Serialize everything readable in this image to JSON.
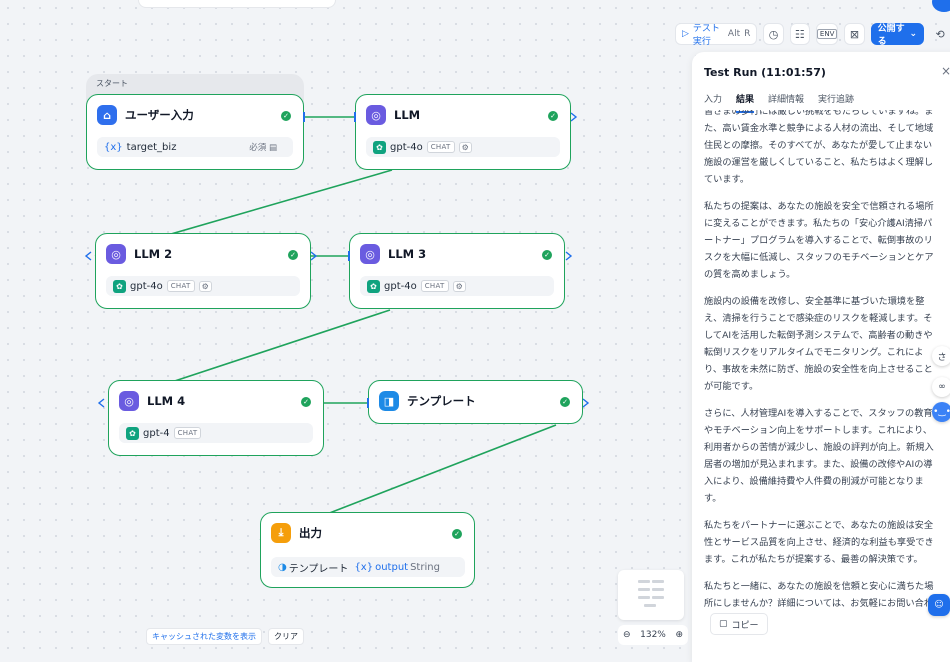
{
  "toolbar": {
    "test_run_label": "テスト実行",
    "test_run_shortcut_alt": "Alt",
    "test_run_shortcut_key": "R",
    "env_label": "ENV",
    "publish_label": "公開する",
    "publish_chevron": "⌄"
  },
  "panel": {
    "title": "Test Run (11:01:57)",
    "close_glyph": "×",
    "tabs": [
      {
        "label": "入力"
      },
      {
        "label": "結果"
      },
      {
        "label": "詳細情報"
      },
      {
        "label": "実行追跡"
      }
    ],
    "active_tab": "結果",
    "paragraphs": [
      "皆さまの歩行には厳しい挑戦をもたらしていますね。また、高い賃金水準と競争による人材の流出、そして地域住民との摩擦。そのすべてが、あなたが愛して止まない施設の運営を厳しくしていること、私たちはよく理解しています。",
      "私たちの提案は、あなたの施設を安全で信頼される場所に変えることができます。私たちの「安心介護AI清掃パートナー」プログラムを導入することで、転倒事故のリスクを大幅に低減し、スタッフのモチベーションとケアの質を高めましょう。",
      "施設内の設備を改修し、安全基準に基づいた環境を整え、清掃を行うことで感染症のリスクを軽減します。そしてAIを活用した転倒予測システムで、高齢者の動きや転倒リスクをリアルタイムでモニタリング。これにより、事故を未然に防ぎ、施設の安全性を向上させることが可能です。",
      "さらに、人材管理AIを導入することで、スタッフの教育やモチベーション向上をサポートします。これにより、利用者からの苦情が減少し、施設の評判が向上。新規入居者の増加が見込まれます。また、設備の改修やAIの導入により、設備維持費や人件費の削減が可能となります。",
      "私たちをパートナーに選ぶことで、あなたの施設は安全性とサービス品質を向上させ、経済的な利益も享受できます。これが私たちが提案する、最善の解決策です。",
      "私たちと一緒に、あなたの施設を信頼と安心に満ちた場所にしませんか？詳細については、お気軽にお問い合わせください。あなたの施設で笑顔が溢れる日々を一緒に作っていきましょう。私たちはあなたの連絡を、心からお待ちしています。"
    ],
    "copy_label": "コピー"
  },
  "side_floats": {
    "first_glyph": "さ"
  },
  "workflow": {
    "start_label": "スタート",
    "nodes": {
      "user_input": {
        "title": "ユーザー入力",
        "var_prefix": "{x}",
        "var_name": "target_biz",
        "required": "必須"
      },
      "llm1": {
        "title": "LLM",
        "model": "gpt-4o",
        "mode": "CHAT"
      },
      "llm2": {
        "title": "LLM 2",
        "model": "gpt-4o",
        "mode": "CHAT"
      },
      "llm3": {
        "title": "LLM 3",
        "model": "gpt-4o",
        "mode": "CHAT"
      },
      "llm4": {
        "title": "LLM 4",
        "model": "gpt-4",
        "mode": "CHAT"
      },
      "template": {
        "title": "テンプレート"
      },
      "output": {
        "title": "出力",
        "source": "テンプレート",
        "var_prefix": "{x}",
        "var_name": "output",
        "var_type": "String"
      }
    }
  },
  "bottom": {
    "show_cached_label": "キャッシュされた変数を表示",
    "clear_label": "クリア",
    "zoom_level": "132%"
  },
  "colors": {
    "accent": "#1f6feb",
    "success": "#1fa35c"
  }
}
